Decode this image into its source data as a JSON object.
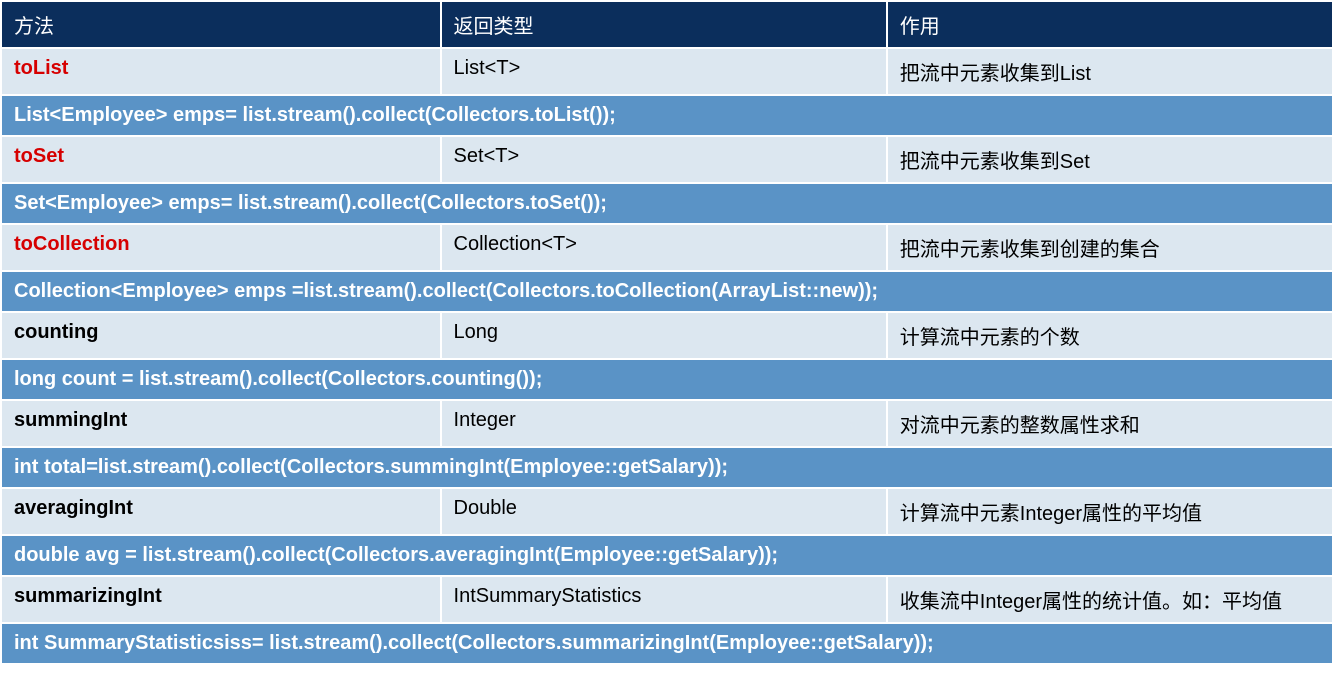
{
  "headers": {
    "method": "方法",
    "return_type": "返回类型",
    "description": "作用"
  },
  "rows": [
    {
      "method": "toList",
      "method_red": true,
      "return_type": "List<T>",
      "description": "把流中元素收集到List",
      "code": "List<Employee> emps= list.stream().collect(Collectors.toList());"
    },
    {
      "method": "toSet",
      "method_red": true,
      "return_type": "Set<T>",
      "description": "把流中元素收集到Set",
      "code": "Set<Employee> emps= list.stream().collect(Collectors.toSet());"
    },
    {
      "method": "toCollection",
      "method_red": true,
      "return_type": "Collection<T>",
      "description": "把流中元素收集到创建的集合",
      "code": "Collection<Employee> emps =list.stream().collect(Collectors.toCollection(ArrayList::new));"
    },
    {
      "method": "counting",
      "method_red": false,
      "return_type": "Long",
      "description": "计算流中元素的个数",
      "code": "long count = list.stream().collect(Collectors.counting());"
    },
    {
      "method": "summingInt",
      "method_red": false,
      "return_type": "Integer",
      "description": "对流中元素的整数属性求和",
      "code": "int total=list.stream().collect(Collectors.summingInt(Employee::getSalary));"
    },
    {
      "method": "averagingInt",
      "method_red": false,
      "return_type": "Double",
      "description": "计算流中元素Integer属性的平均值",
      "code": "double avg = list.stream().collect(Collectors.averagingInt(Employee::getSalary));"
    },
    {
      "method": "summarizingInt",
      "method_red": false,
      "return_type": "IntSummaryStatistics",
      "description": "收集流中Integer属性的统计值。如：平均值",
      "code": "int SummaryStatisticsiss= list.stream().collect(Collectors.summarizingInt(Employee::getSalary));"
    }
  ]
}
